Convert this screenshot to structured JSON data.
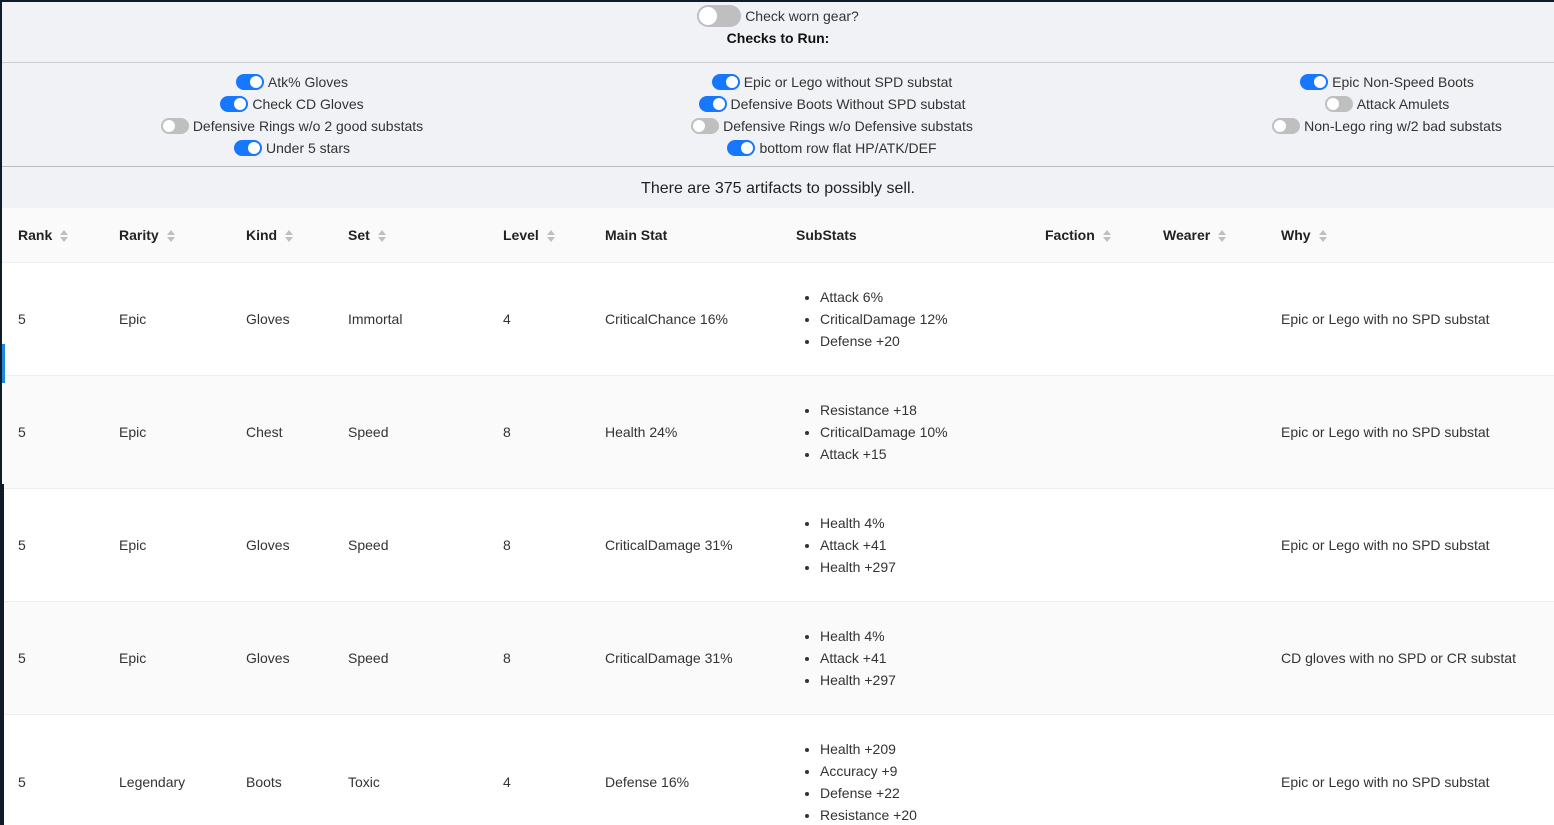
{
  "top": {
    "worn_label": "Check worn gear?",
    "checks_title": "Checks to Run:"
  },
  "checks": {
    "col1": [
      {
        "label": "Atk% Gloves",
        "on": true
      },
      {
        "label": "Check CD Gloves",
        "on": true
      },
      {
        "label": "Defensive Rings w/o 2 good substats",
        "on": false
      },
      {
        "label": "Under 5 stars",
        "on": true
      }
    ],
    "col2": [
      {
        "label": "Epic or Lego without SPD substat",
        "on": true
      },
      {
        "label": "Defensive Boots Without SPD substat",
        "on": true
      },
      {
        "label": "Defensive Rings w/o Defensive substats",
        "on": false
      },
      {
        "label": "bottom row flat HP/ATK/DEF",
        "on": true
      }
    ],
    "col3": [
      {
        "label": "Epic Non-Speed Boots",
        "on": true
      },
      {
        "label": "Attack Amulets",
        "on": false
      },
      {
        "label": "Non-Lego ring w/2 bad substats",
        "on": false
      }
    ]
  },
  "summary": "There are 375 artifacts to possibly sell.",
  "table": {
    "headers": {
      "rank": "Rank",
      "rarity": "Rarity",
      "kind": "Kind",
      "set": "Set",
      "level": "Level",
      "main_stat": "Main Stat",
      "substats": "SubStats",
      "faction": "Faction",
      "wearer": "Wearer",
      "why": "Why"
    },
    "rows": [
      {
        "rank": "5",
        "rarity": "Epic",
        "kind": "Gloves",
        "set": "Immortal",
        "level": "4",
        "main_stat": "CriticalChance 16%",
        "substats": [
          "Attack 6%",
          "CriticalDamage 12%",
          "Defense +20"
        ],
        "faction": "",
        "wearer": "",
        "why": "Epic or Lego with no SPD substat"
      },
      {
        "rank": "5",
        "rarity": "Epic",
        "kind": "Chest",
        "set": "Speed",
        "level": "8",
        "main_stat": "Health 24%",
        "substats": [
          "Resistance +18",
          "CriticalDamage 10%",
          "Attack +15"
        ],
        "faction": "",
        "wearer": "",
        "why": "Epic or Lego with no SPD substat"
      },
      {
        "rank": "5",
        "rarity": "Epic",
        "kind": "Gloves",
        "set": "Speed",
        "level": "8",
        "main_stat": "CriticalDamage 31%",
        "substats": [
          "Health 4%",
          "Attack +41",
          "Health +297"
        ],
        "faction": "",
        "wearer": "",
        "why": "Epic or Lego with no SPD substat"
      },
      {
        "rank": "5",
        "rarity": "Epic",
        "kind": "Gloves",
        "set": "Speed",
        "level": "8",
        "main_stat": "CriticalDamage 31%",
        "substats": [
          "Health 4%",
          "Attack +41",
          "Health +297"
        ],
        "faction": "",
        "wearer": "",
        "why": "CD gloves with no SPD or CR substat"
      },
      {
        "rank": "5",
        "rarity": "Legendary",
        "kind": "Boots",
        "set": "Toxic",
        "level": "4",
        "main_stat": "Defense 16%",
        "substats": [
          "Health +209",
          "Accuracy +9",
          "Defense +22",
          "Resistance +20"
        ],
        "faction": "",
        "wearer": "",
        "why": "Epic or Lego with no SPD substat"
      }
    ]
  }
}
